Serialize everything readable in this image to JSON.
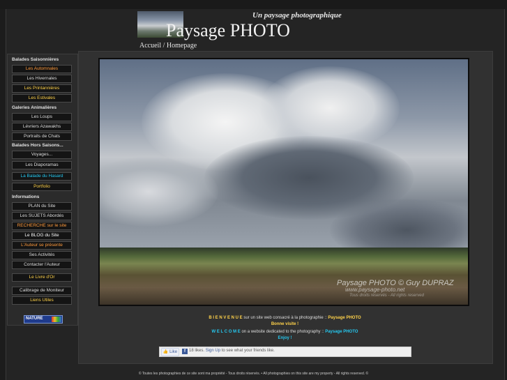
{
  "header": {
    "tagline": "Un paysage photographique",
    "title": "Paysage PHOTO",
    "breadcrumb": "Accueil / Homepage"
  },
  "sidebar": {
    "sections": [
      {
        "title": "Balades Saisonnières",
        "items": [
          {
            "label": "Les Automnales",
            "color": "#ff9a3c"
          },
          {
            "label": "Les Hivernales",
            "color": "#dddddd"
          },
          {
            "label": "Les Printannières",
            "color": "#ffd24a"
          },
          {
            "label": "Les Estivales",
            "color": "#ffd24a"
          }
        ]
      },
      {
        "title": "Galeries Animalières",
        "items": [
          {
            "label": "Les Loups",
            "color": "#dddddd"
          },
          {
            "label": "Lévriers Azawakhs",
            "color": "#dddddd"
          },
          {
            "label": "Portraits de Chats",
            "color": "#dddddd"
          }
        ]
      },
      {
        "title": "Balades Hors Saisons...",
        "items": [
          {
            "label": "Voyages...",
            "color": "#dddddd"
          },
          {
            "label": "Les Diaporamas",
            "color": "#dddddd"
          },
          {
            "label": "La Balade du Hasard",
            "color": "#25c8f0"
          },
          {
            "label": "Portfolio",
            "color": "#ffd24a"
          }
        ]
      },
      {
        "title": "Informations",
        "items": [
          {
            "label": "PLAN du Site",
            "color": "#dddddd"
          },
          {
            "label": "Les SUJETS Abordés",
            "color": "#dddddd"
          },
          {
            "label": "RECHERCHE sur le site",
            "color": "#ff9a3c"
          },
          {
            "label": "Le BLOG du Site",
            "color": "#ffffff"
          },
          {
            "label": "L'Auteur se présente",
            "color": "#ff9a3c"
          },
          {
            "label": "Ses Activités",
            "color": "#dddddd"
          },
          {
            "label": "Contacter l'Auteur",
            "color": "#dddddd"
          },
          {
            "label": "Le Livre d'Or",
            "color": "#ffd24a"
          },
          {
            "label": "Calibrage de Moniteur",
            "color": "#dddddd"
          },
          {
            "label": "Liens Utiles",
            "color": "#ffd24a"
          }
        ]
      }
    ],
    "badge": "NATURE"
  },
  "photo": {
    "watermark": "Paysage PHOTO © Guy DUPRAZ",
    "watermark_url": "www.paysage-photo.net",
    "watermark_rights": "Tous droits réservés - All rights reserved"
  },
  "welcome": {
    "fr_prefix": "B I E N V E N U E",
    "fr_text": " sur un site web consacré à la photographie :: ",
    "fr_site": "Paysage PHOTO",
    "fr_bye": "Bonne visite !",
    "en_prefix": "W E L C O M E",
    "en_text": " on a website dedicated to the photography :: ",
    "en_site": "Paysage PHOTO",
    "en_bye": "Enjoy !"
  },
  "facebook": {
    "like_label": "Like",
    "count": "18 likes.",
    "signup": "Sign Up",
    "suffix": " to see what your friends like."
  },
  "footer": {
    "text": "© Toutes les photographies de ce site sont ma propriété - Tous droits réservés. • All photographies on this site are my property - All rights reserved. ©"
  },
  "colors": {
    "background": "#1c1c1c",
    "accent_yellow": "#ffd24a",
    "accent_cyan": "#25c8f0",
    "accent_orange": "#ff9a3c"
  }
}
